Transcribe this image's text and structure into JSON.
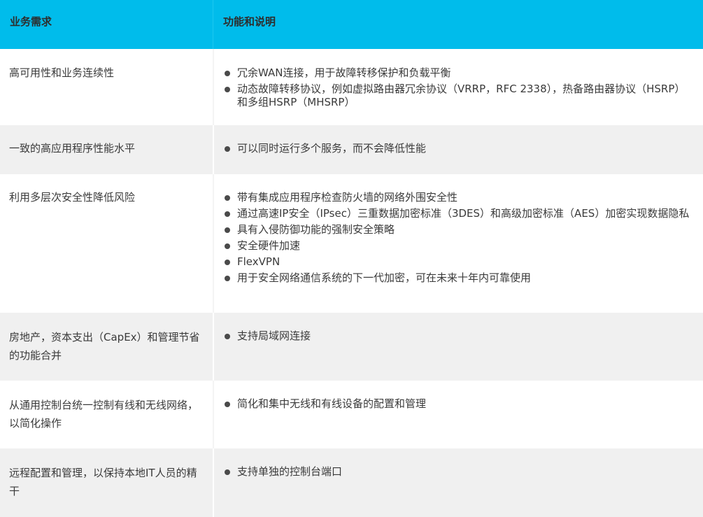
{
  "header": {
    "col1": "业务需求",
    "col2": "功能和说明"
  },
  "colors": {
    "header_bg": "#00bceb",
    "alt_row_bg": "#f0f0f0",
    "text": "#3a3a3a"
  },
  "rows": [
    {
      "need": "高可用性和业务连续性",
      "features": [
        "冗余WAN连接，用于故障转移保护和负载平衡",
        "动态故障转移协议，例如虚拟路由器冗余协议（VRRP，RFC 2338），热备路由器协议（HSRP）和多组HSRP（MHSRP）"
      ]
    },
    {
      "need": "一致的高应用程序性能水平",
      "features": [
        "可以同时运行多个服务，而不会降低性能"
      ]
    },
    {
      "need": "利用多层次安全性降低风险",
      "features": [
        "带有集成应用程序检查防火墙的网络外围安全性",
        "通过高速IP安全（IPsec）三重数据加密标准（3DES）和高级加密标准（AES）加密实现数据隐私",
        "具有入侵防御功能的强制安全策略",
        "安全硬件加速",
        "FlexVPN",
        "用于安全网络通信系统的下一代加密，可在未来十年内可靠使用"
      ]
    },
    {
      "need": "房地产，资本支出（CapEx）和管理节省的功能合并",
      "features": [
        "支持局域网连接"
      ]
    },
    {
      "need": "从通用控制台统一控制有线和无线网络，以简化操作",
      "features": [
        "简化和集中无线和有线设备的配置和管理"
      ]
    },
    {
      "need": "远程配置和管理，以保持本地IT人员的精干",
      "features": [
        "支持单独的控制台端口"
      ]
    }
  ]
}
